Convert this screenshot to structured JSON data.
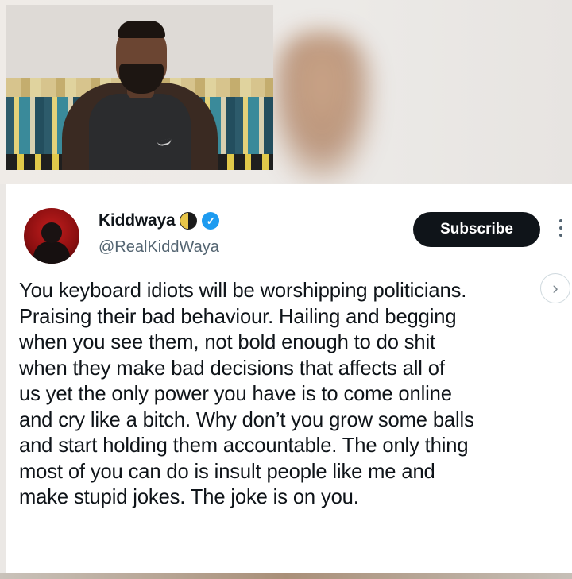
{
  "tweet": {
    "author_name": "Kiddwaya",
    "author_handle": "@RealKiddWaya",
    "subscribe_label": "Subscribe",
    "text": "You keyboard idiots will be worshipping politicians.\nPraising their bad behaviour. Hailing and begging\nwhen you see them, not bold enough to do shit\nwhen they make bad decisions that affects all of\nus yet the only power you have is to come online\nand cry like a bitch. Why don’t you grow some balls\nand start holding them accountable. The only thing\nmost of you can do is insult people like me and\nmake stupid jokes. The joke is on you."
  },
  "icons": {
    "verified": "verified-badge-icon",
    "emoji": "moon-emoji-icon",
    "more": "more-options-icon",
    "next": "chevron-right-icon"
  },
  "colors": {
    "subscribe_bg": "#0f1419",
    "verified": "#1d9bf0",
    "handle": "#536471",
    "avatar": "#c21d1d"
  }
}
